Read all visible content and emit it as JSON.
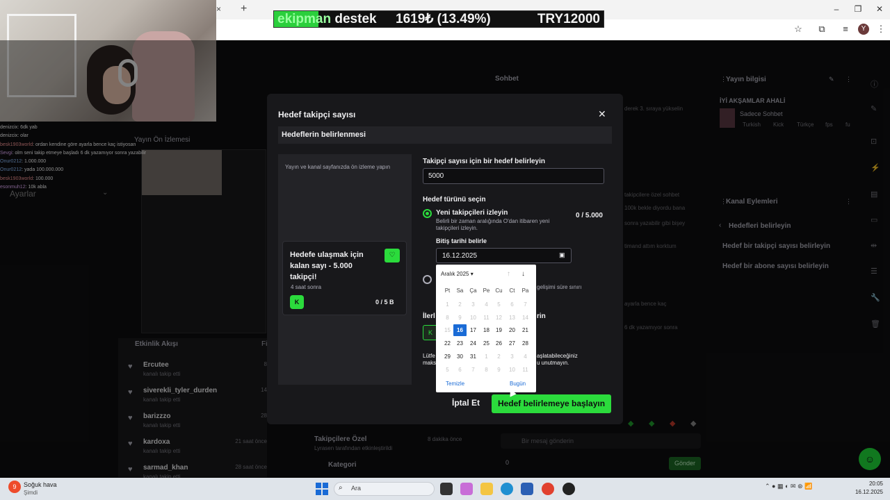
{
  "overlay": {
    "goal_highlight": "ekipman",
    "goal_rest": " destek",
    "progress": "1619₺ (13.49%)",
    "target": "TRY12000",
    "progress_fraction": 0.1349
  },
  "browser": {
    "tab_close": "×",
    "new_tab": "+",
    "profile_initial": "Y"
  },
  "stream_chat": [
    {
      "user": "denizcix",
      "text": ": 6dk yab"
    },
    {
      "user": "denizcix",
      "text": ": olar"
    },
    {
      "user": "besk1903world",
      "text": ": ordan kendine göre ayarla bence kaç istiyosan"
    },
    {
      "user": "Sevgi",
      "text": ": olm seni takip etmeye başladı 6 dk yazamıyor sonra yazabilir"
    },
    {
      "user": "Onur0212",
      "text": ": 1.000.000"
    },
    {
      "user": "Onur0212",
      "text": ": yada 100.000.000"
    },
    {
      "user": "besk1903world",
      "text": ": 100.000"
    },
    {
      "user": "esonmuh12",
      "text": ": 10k abla"
    }
  ],
  "left": {
    "settings": "Ayarlar",
    "preview_title": "Yayın Ön İzlemesi",
    "activity_title": "Etkinlik Akışı",
    "activity_col": "Fi",
    "activity_items": [
      {
        "name": "Ercutee",
        "sub": "kanalı takip etti",
        "time": "8"
      },
      {
        "name": "siverekli_tyler_durden",
        "sub": "kanalı takip etti",
        "time": "14"
      },
      {
        "name": "barizzzo",
        "sub": "kanalı takip etti",
        "time": "28"
      },
      {
        "name": "kardoxa",
        "sub": "kanalı takip etti",
        "time": "21 saat önce"
      },
      {
        "name": "sarmad_khan",
        "sub": "kanalı takip etti",
        "time": "28 saat önce"
      }
    ]
  },
  "chat": {
    "title": "Sohbet",
    "bg_lines": [
      "derek 3. sıraya yükselin",
      "takipcilere özel sohbet",
      "100k bekle diyordu bana",
      "sonra yazabilir gibi bişey",
      "timand attım korktum",
      "ayarla bence kaç",
      "6 dk yazamıyor sonra"
    ],
    "input_placeholder": "Bir mesaj gönderin",
    "send": "Gönder",
    "points": "0",
    "bottom_items": [
      {
        "label": "Takipçilere Özel",
        "time": "8 dakika önce",
        "sub": "Lyrasen tarafından etkinleştirildi"
      },
      {
        "label": "Kategori"
      }
    ]
  },
  "stream_info": {
    "title": "Yayın bilgisi",
    "stream_name": "İYİ AKŞAMLAR AHALİ",
    "category": "Sadece Sohbet",
    "tags": [
      "Turkish",
      "Kick",
      "Türkçe",
      "fps",
      "fu"
    ]
  },
  "channel_actions": {
    "title": "Kanal Eylemleri",
    "back": "Hedefleri belirleyin",
    "items": [
      "Hedef bir takipçi sayısı belirleyin",
      "Hedef bir abone sayısı belirleyin"
    ]
  },
  "modal": {
    "title": "Hedef takipçi sayısı",
    "section": "Hedeflerin belirlenmesi",
    "preview_caption": "Yayın ve kanal sayfanızda ön izleme yapın",
    "card_title": "Hedefe ulaşmak için kalan sayı - 5.000 takipçi!",
    "card_time": "4 saat sonra",
    "card_count": "0 / 5 B",
    "field_label": "Takipçi sayısı için bir hedef belirleyin",
    "field_value": "5000",
    "type_label": "Hedef türünü seçin",
    "option_new_label": "Yeni takipçileri izleyin",
    "option_new_desc": "Belirli bir zaman aralığında O'dan itibaren yeni takipçileri izleyin.",
    "option_new_count": "0 / 5.000",
    "end_date_label": "Bitiş tarihi belirle",
    "end_date_value": "16.12.2025",
    "other_desc": "gelişimi süre sınırı",
    "adv_label_a": "İlerl",
    "adv_label_b": "rin",
    "note_a": "Lütfe\nmaks",
    "note_b": "aşlatabileceğiniz\nu unutmayın.",
    "cancel": "İptal Et",
    "start": "Hedef belirlemeye başlayın"
  },
  "datepicker": {
    "month": "Aralık 2025",
    "weekdays": [
      "Pt",
      "Sa",
      "Ça",
      "Pe",
      "Cu",
      "Ct",
      "Pa"
    ],
    "weeks": [
      [
        "1",
        "2",
        "3",
        "4",
        "5",
        "6",
        "7"
      ],
      [
        "8",
        "9",
        "10",
        "11",
        "12",
        "13",
        "14"
      ],
      [
        "15",
        "16",
        "17",
        "18",
        "19",
        "20",
        "21"
      ],
      [
        "22",
        "23",
        "24",
        "25",
        "26",
        "27",
        "28"
      ],
      [
        "29",
        "30",
        "31",
        "1",
        "2",
        "3",
        "4"
      ],
      [
        "5",
        "6",
        "7",
        "8",
        "9",
        "10",
        "11"
      ]
    ],
    "selected": "16",
    "clear": "Temizle",
    "today": "Bugün"
  },
  "taskbar": {
    "weather_title": "Soğuk hava",
    "weather_sub": "Şimdi",
    "weather_badge": "9",
    "search": "Ara",
    "time": "20:05",
    "date": "16.12.2025"
  },
  "colors": {
    "accent": "#2bdb3c",
    "selected_day": "#1a6bd6"
  }
}
